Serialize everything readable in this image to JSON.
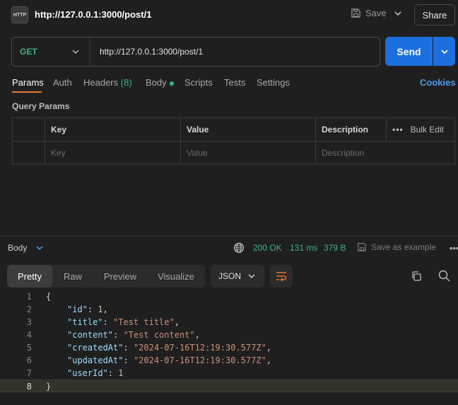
{
  "header": {
    "icon": "http-icon",
    "icon_text": "HTTP",
    "title": "http://127.0.0.1:3000/post/1",
    "save_label": "Save",
    "share_label": "Share"
  },
  "request": {
    "method": "GET",
    "url": "http://127.0.0.1:3000/post/1",
    "send_label": "Send"
  },
  "tabs": {
    "params": "Params",
    "auth": "Auth",
    "headers": "Headers",
    "headers_count": "(8)",
    "body": "Body",
    "scripts": "Scripts",
    "tests": "Tests",
    "settings": "Settings",
    "cookies": "Cookies"
  },
  "query_params": {
    "title": "Query Params",
    "columns": [
      "Key",
      "Value",
      "Description"
    ],
    "bulk_edit": "Bulk Edit",
    "placeholders": [
      "Key",
      "Value",
      "Description"
    ]
  },
  "response": {
    "body_label": "Body",
    "status": "200 OK",
    "time": "131 ms",
    "size": "379 B",
    "save_example": "Save as example",
    "views": [
      "Pretty",
      "Raw",
      "Preview",
      "Visualize"
    ],
    "format": "JSON",
    "line_numbers": [
      "1",
      "2",
      "3",
      "4",
      "5",
      "6",
      "7",
      "8"
    ],
    "json": {
      "open": "{",
      "close": "}",
      "fields": [
        {
          "key": "\"id\"",
          "value": "1",
          "type": "number",
          "comma": ","
        },
        {
          "key": "\"title\"",
          "value": "\"Test title\"",
          "type": "string",
          "comma": ","
        },
        {
          "key": "\"content\"",
          "value": "\"Test content\"",
          "type": "string",
          "comma": ","
        },
        {
          "key": "\"createdAt\"",
          "value": "\"2024-07-16T12:19:30.577Z\"",
          "type": "string",
          "comma": ","
        },
        {
          "key": "\"updatedAt\"",
          "value": "\"2024-07-16T12:19:30.577Z\"",
          "type": "string",
          "comma": ","
        },
        {
          "key": "\"userId\"",
          "value": "1",
          "type": "number",
          "comma": ""
        }
      ]
    }
  },
  "colors": {
    "accent": "#1d6fe0",
    "success": "#3fb27f",
    "tab_underline": "#e97631",
    "link": "#4a9cf0"
  }
}
